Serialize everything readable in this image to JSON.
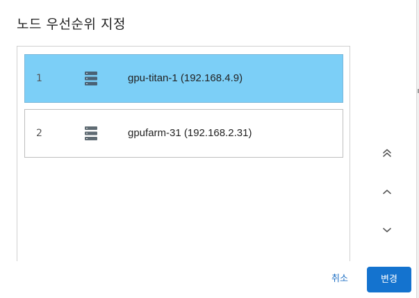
{
  "dialog": {
    "title": "노드 우선순위 지정"
  },
  "nodes": [
    {
      "rank": "1",
      "label": "gpu-titan-1 (192.168.4.9)",
      "icon": "server-icon",
      "selected": true
    },
    {
      "rank": "2",
      "label": "gpufarm-31 (192.168.2.31)",
      "icon": "server-icon",
      "selected": false
    }
  ],
  "order_controls": [
    {
      "icon": "double-chevron-up-icon"
    },
    {
      "icon": "chevron-up-icon"
    },
    {
      "icon": "chevron-down-icon"
    }
  ],
  "footer": {
    "cancel_label": "취소",
    "confirm_label": "변경"
  },
  "colors": {
    "selected_row": "#7ccff7",
    "primary_button": "#1473cf",
    "link": "#1d6fc4"
  }
}
